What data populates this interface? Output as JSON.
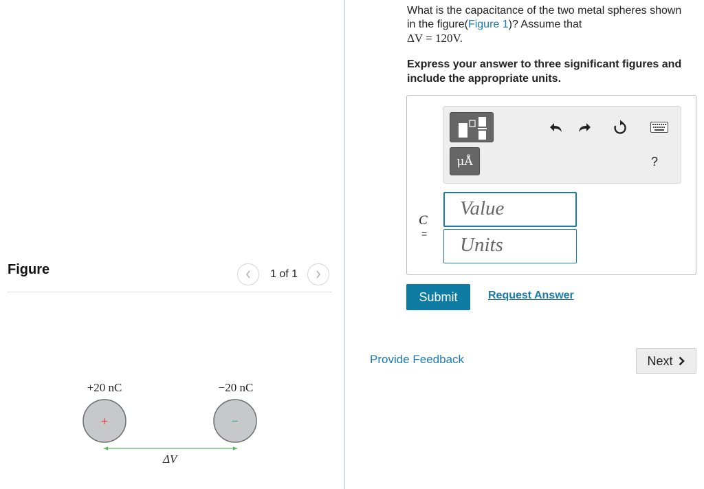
{
  "figure_panel": {
    "title": "Figure",
    "pager": {
      "text": "1 of 1",
      "prev_icon": "chevron-left-icon",
      "next_icon": "chevron-right-icon"
    },
    "diagram": {
      "left_charge_label": "+20 nC",
      "right_charge_label": "−20 nC",
      "left_sign": "+",
      "right_sign": "−",
      "potential_label": "ΔV",
      "sphere_fill": "#c6c8c9",
      "sphere_stroke": "#6d6e70",
      "arrow_color": "#5bb760",
      "plus_color": "#e04040",
      "minus_color": "#35b0a4"
    }
  },
  "question": {
    "text_before_link": "What is the capacitance of the two metal spheres shown in the figure(",
    "link_text": "Figure 1",
    "text_after_link": ")? Assume that",
    "condition": "ΔV = 120V."
  },
  "instruction": "Express your answer to three significant figures and include the appropriate units.",
  "toolbar": {
    "template_icon": "fraction-template-icon",
    "units_button_label": "μÅ",
    "undo_icon": "undo-icon",
    "redo_icon": "redo-icon",
    "reset_icon": "reset-icon",
    "keyboard_icon": "keyboard-icon",
    "help_label": "?"
  },
  "answer": {
    "variable": "C",
    "equals": "=",
    "value_placeholder": "Value",
    "units_placeholder": "Units"
  },
  "buttons": {
    "submit": "Submit",
    "request_answer": "Request Answer",
    "provide_feedback": "Provide Feedback",
    "next": "Next"
  },
  "colors": {
    "accent": "#1a7ab0",
    "submit_bg": "#0e7ba2",
    "toolbar_button": "#666666"
  }
}
